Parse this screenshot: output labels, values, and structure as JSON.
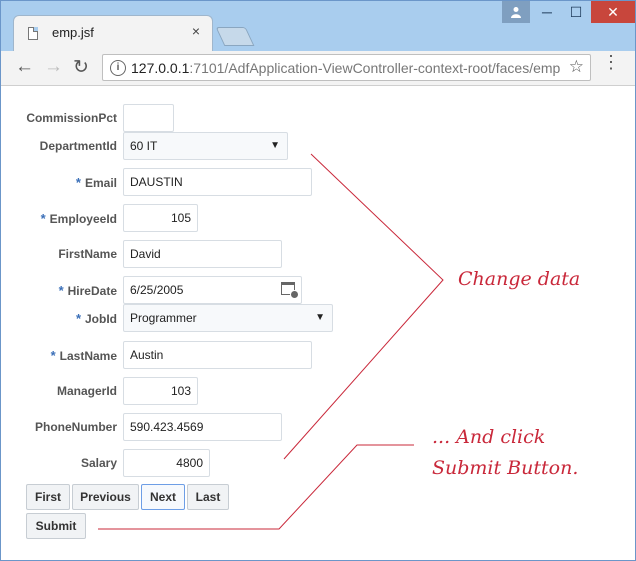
{
  "browser": {
    "tab_title": "emp.jsf",
    "tab_close": "×",
    "url_host": "127.0.0.1",
    "url_rest": ":7101/AdfApplication-ViewController-context-root/faces/emp",
    "info": "i",
    "star": "☆",
    "back": "←",
    "forward": "→",
    "reload": "↻",
    "menu": "⋮",
    "minimize": "─",
    "maximize": "☐",
    "close": "✕",
    "user": "👤"
  },
  "form": {
    "required_marker": "*",
    "commission_pct": {
      "label": "CommissionPct",
      "value": ""
    },
    "department_id": {
      "label": "DepartmentId",
      "value": "60 IT"
    },
    "email": {
      "label": "Email",
      "value": "DAUSTIN"
    },
    "employee_id": {
      "label": "EmployeeId",
      "value": "105"
    },
    "first_name": {
      "label": "FirstName",
      "value": "David"
    },
    "hire_date": {
      "label": "HireDate",
      "value": "6/25/2005"
    },
    "job_id": {
      "label": "JobId",
      "value": "Programmer"
    },
    "last_name": {
      "label": "LastName",
      "value": "Austin"
    },
    "manager_id": {
      "label": "ManagerId",
      "value": "103"
    },
    "phone_number": {
      "label": "PhoneNumber",
      "value": "590.423.4569"
    },
    "salary": {
      "label": "Salary",
      "value": "4800"
    },
    "dropdown_caret": "▼"
  },
  "buttons": {
    "first": "First",
    "previous": "Previous",
    "next": "Next",
    "last": "Last",
    "submit": "Submit"
  },
  "annotations": {
    "change_data": "Change data",
    "and_click": "... And click",
    "submit_button": "Submit Button."
  },
  "colors": {
    "annotation": "#c9283a",
    "required": "#3a6fb8",
    "titlebar": "#a9cdee"
  }
}
